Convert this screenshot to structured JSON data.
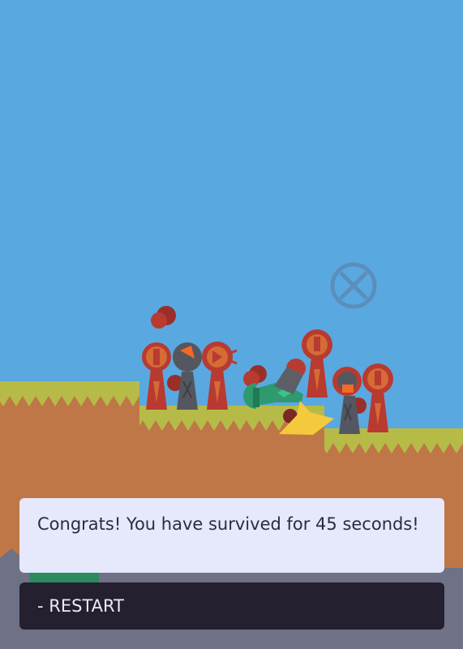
{
  "message": "Congrats! You have survived for 45 seconds!",
  "restart_label": "- RESTART",
  "colors": {
    "sky": "#5aa8e0",
    "dirt": "#bf7747",
    "grass": "#b6bb48",
    "enemy_red": "#b83a30",
    "enemy_dark": "#7e2626",
    "enemy_orange": "#d56b35",
    "tower_gray": "#54575f",
    "player_green": "#2e9a6e",
    "slash_yellow": "#f5c93c",
    "message_bg": "#e6e8fb",
    "button_bg": "#24202f",
    "rocks": "#6f7186"
  },
  "icons": [
    "crosshair-icon"
  ]
}
